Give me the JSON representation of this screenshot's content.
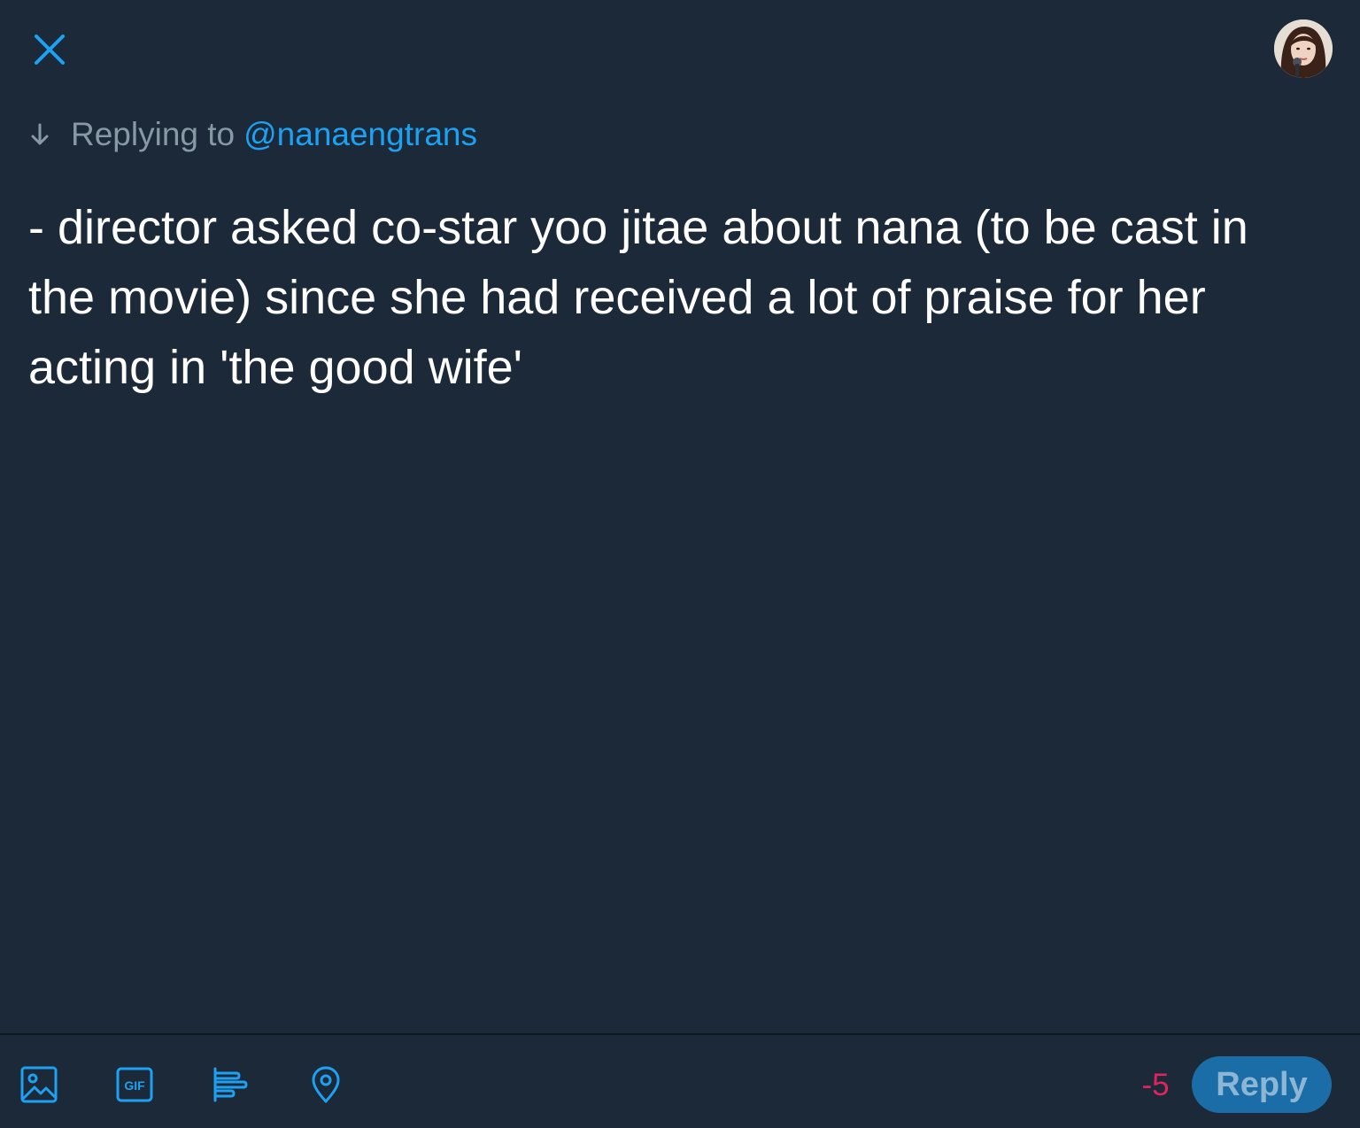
{
  "header": {
    "close_icon": "close-icon",
    "avatar_icon": "profile-avatar"
  },
  "reply_context": {
    "prefix": "Replying to",
    "handle": "@nanaengtrans"
  },
  "composer": {
    "text": "- director asked co-star yoo jitae about nana (to be cast in the movie) since she had received a lot of praise for her acting in 'the good wife'"
  },
  "toolbar": {
    "icons": [
      "image-icon",
      "gif-icon",
      "poll-icon",
      "location-icon"
    ],
    "char_count": "-5",
    "reply_label": "Reply"
  },
  "colors": {
    "background": "#1c2938",
    "accent": "#1da1f2",
    "muted": "#8899a6",
    "over_limit": "#e0245e",
    "reply_button_disabled": "#1a6da6"
  }
}
